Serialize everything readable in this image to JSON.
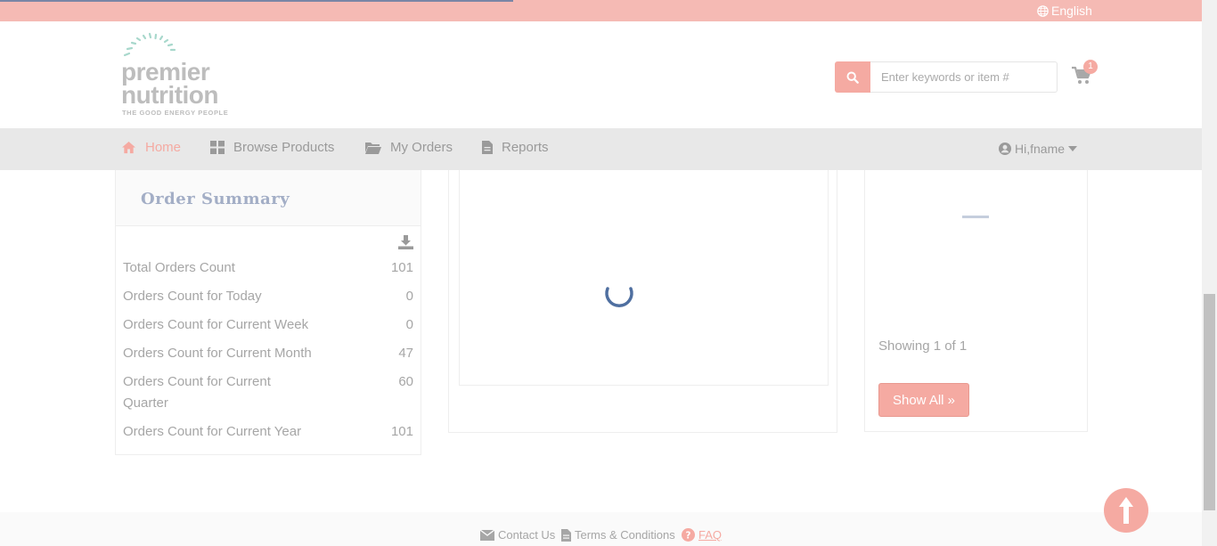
{
  "topbar": {
    "language": "English"
  },
  "logo": {
    "line1": "premier",
    "line2": "nutrition",
    "tagline": "THE GOOD ENERGY PEOPLE"
  },
  "search": {
    "placeholder": "Enter keywords or item #"
  },
  "cart": {
    "count": "1"
  },
  "nav": {
    "items": [
      {
        "label": "Home",
        "icon": "home-icon"
      },
      {
        "label": "Browse Products",
        "icon": "grid-icon"
      },
      {
        "label": "My Orders",
        "icon": "folder-icon"
      },
      {
        "label": "Reports",
        "icon": "file-icon"
      }
    ],
    "user": "Hi,fname"
  },
  "order_summary": {
    "title": "Order Summary",
    "rows": [
      {
        "label": "Total Orders Count",
        "value": "101"
      },
      {
        "label": "Orders Count for Today",
        "value": "0"
      },
      {
        "label": "Orders Count for Current Week",
        "value": "0"
      },
      {
        "label": "Orders Count for Current Month",
        "value": "47"
      },
      {
        "label": "Orders Count for Current Quarter",
        "value": "60"
      },
      {
        "label": "Orders Count for Current Year",
        "value": "101"
      }
    ]
  },
  "right_panel": {
    "showing": "Showing 1 of 1",
    "show_all": "Show All »"
  },
  "footer": {
    "contact": "Contact Us",
    "terms": "Terms & Conditions",
    "faq": "FAQ"
  },
  "colors": {
    "accent": "#f5aaa2",
    "topbar": "#f5bab4",
    "nav_bg": "#e8e8e8",
    "title": "#a3aec6"
  }
}
